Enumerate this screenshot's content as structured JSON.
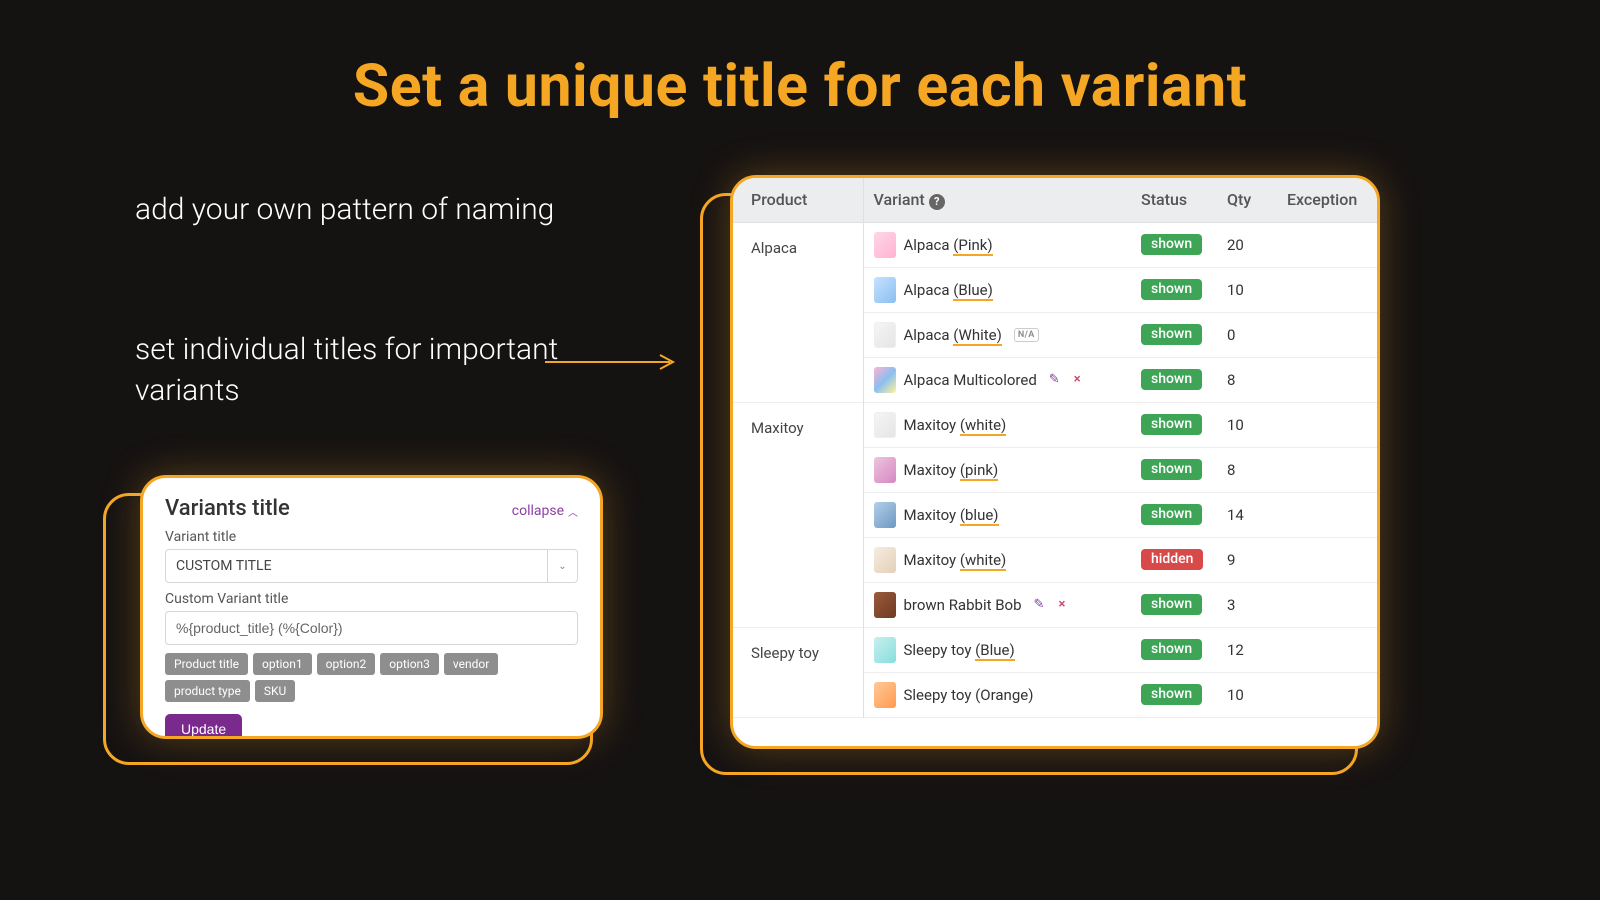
{
  "hero": "Set a unique title for each variant",
  "blurb1": "add your own pattern of naming",
  "blurb2": "set individual titles for important variants",
  "panel": {
    "title": "Variants title",
    "collapse": "collapse",
    "label1": "Variant title",
    "select_value": "CUSTOM TITLE",
    "label2": "Custom Variant title",
    "input_value": "%{product_title} (%{Color})",
    "tags": [
      "Product title",
      "option1",
      "option2",
      "option3",
      "vendor",
      "product type",
      "SKU"
    ],
    "update": "Update"
  },
  "table": {
    "headers": {
      "product": "Product",
      "variant": "Variant",
      "status": "Status",
      "qty": "Qty",
      "exception": "Exception"
    },
    "status_shown": "shown",
    "status_hidden": "hidden",
    "na": "N/A",
    "rows": [
      {
        "product": "Alpaca",
        "variant_pre": "Alpaca ",
        "variant_hl": "(Pink)",
        "thumb": "pink",
        "status": "shown",
        "qty": "20"
      },
      {
        "product": "",
        "variant_pre": "Alpaca ",
        "variant_hl": "(Blue)",
        "thumb": "blue",
        "status": "shown",
        "qty": "10"
      },
      {
        "product": "",
        "variant_pre": "Alpaca ",
        "variant_hl": "(White)",
        "thumb": "white",
        "na": true,
        "status": "shown",
        "qty": "0"
      },
      {
        "product": "",
        "variant_pre": "Alpaca Multicolored",
        "variant_hl": "",
        "thumb": "multi",
        "edit": true,
        "status": "shown",
        "qty": "8"
      },
      {
        "product": "Maxitoy",
        "variant_pre": "Maxitoy ",
        "variant_hl": "(white)",
        "thumb": "white",
        "status": "shown",
        "qty": "10"
      },
      {
        "product": "",
        "variant_pre": "Maxitoy ",
        "variant_hl": "(pink)",
        "thumb": "mpink",
        "status": "shown",
        "qty": "8"
      },
      {
        "product": "",
        "variant_pre": "Maxitoy ",
        "variant_hl": "(blue)",
        "thumb": "mblue",
        "status": "shown",
        "qty": "14"
      },
      {
        "product": "",
        "variant_pre": "Maxitoy ",
        "variant_hl": "(white)",
        "thumb": "mwhite2",
        "status": "hidden",
        "qty": "9"
      },
      {
        "product": "",
        "variant_pre": "brown Rabbit Bob",
        "variant_hl": "",
        "thumb": "brown",
        "edit": true,
        "status": "shown",
        "qty": "3"
      },
      {
        "product": "Sleepy toy",
        "variant_pre": "Sleepy toy ",
        "variant_hl": "(Blue)",
        "thumb": "sblue",
        "status": "shown",
        "qty": "12"
      },
      {
        "product": "",
        "variant_pre": "Sleepy toy (Orange)",
        "variant_hl": "",
        "thumb": "sorange",
        "status": "shown",
        "qty": "10"
      }
    ]
  }
}
